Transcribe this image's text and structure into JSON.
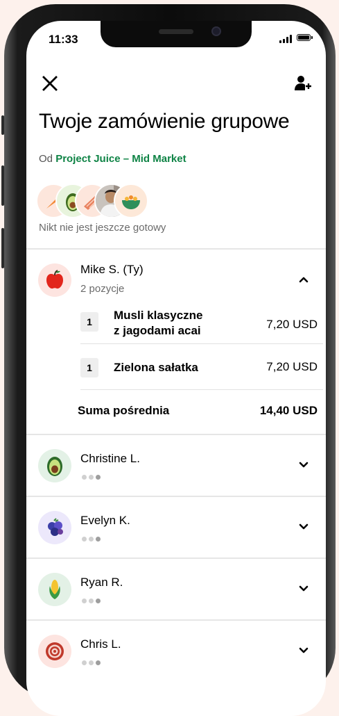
{
  "status_bar": {
    "time": "11:33"
  },
  "header": {
    "title": "Twoje zamówienie grupowe",
    "from_prefix": "Od",
    "store_name": "Project Juice – Mid Market",
    "status": "Nikt nie jest jeszcze gotowy"
  },
  "colors": {
    "accent_green": "#0e8345",
    "text": "#000000",
    "muted": "#6b6b6b"
  },
  "avatar_stack": [
    "carrot-icon",
    "avocado-icon",
    "salmon-icon",
    "person-photo",
    "bowl-icon"
  ],
  "members": [
    {
      "name": "Mike S. (Ty)",
      "subtitle": "2 pozycje",
      "icon": "apple-icon",
      "expanded": true,
      "items": [
        {
          "qty": "1",
          "name_line1": "Musli klasyczne",
          "name_line2": "z jagodami acai",
          "price": "7,20 USD"
        },
        {
          "qty": "1",
          "name_line1": "Zielona sałatka",
          "name_line2": "",
          "price": "7,20 USD"
        }
      ],
      "subtotal_label": "Suma pośrednia",
      "subtotal_value": "14,40 USD"
    },
    {
      "name": "Christine L.",
      "icon": "avocado-icon",
      "expanded": false
    },
    {
      "name": "Evelyn K.",
      "icon": "berries-icon",
      "expanded": false
    },
    {
      "name": "Ryan R.",
      "icon": "corn-icon",
      "expanded": false
    },
    {
      "name": "Chris L.",
      "icon": "onion-icon",
      "expanded": false
    }
  ]
}
